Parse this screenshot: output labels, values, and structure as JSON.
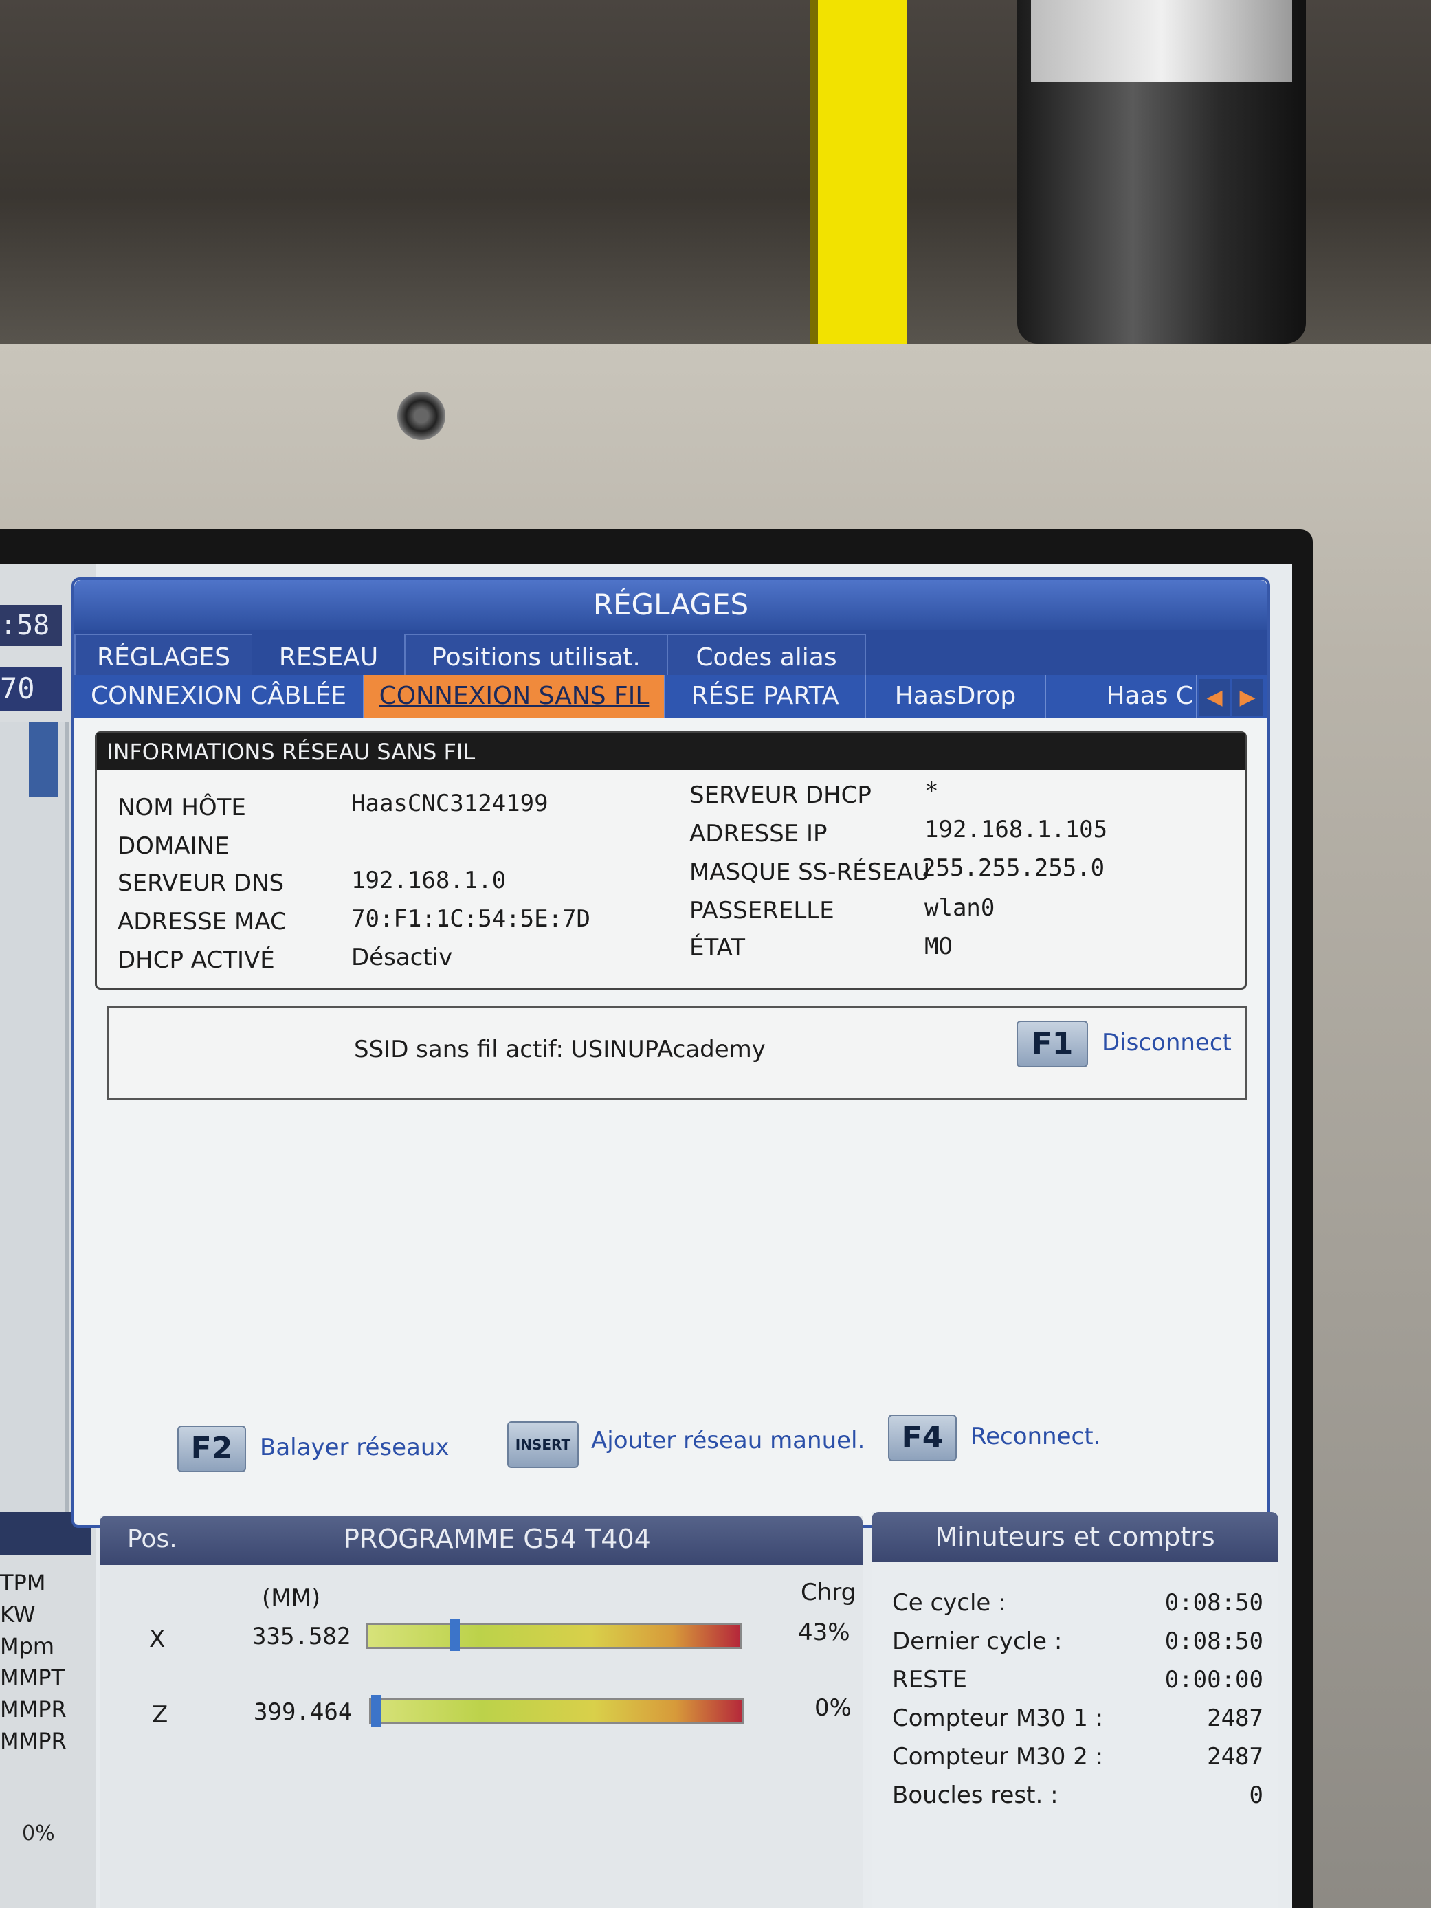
{
  "window": {
    "title": "RÉGLAGES"
  },
  "left_strip": {
    "time_fragment": ":58",
    "number_fragment": "70",
    "labels": [
      "TPM",
      "KW",
      "Mpm",
      "MMPT",
      "MMPR",
      "MMPR"
    ],
    "percent": "0%"
  },
  "tabs_primary": [
    {
      "label": "RÉGLAGES",
      "active": false
    },
    {
      "label": "RESEAU",
      "active": true
    },
    {
      "label": "Positions utilisat.",
      "active": false
    },
    {
      "label": "Codes alias",
      "active": false
    }
  ],
  "tabs_secondary": [
    {
      "label": "CONNEXION CÂBLÉE",
      "active": false
    },
    {
      "label": "CONNEXION SANS FIL",
      "active": true
    },
    {
      "label": "RÉSE PARTA",
      "active": false
    },
    {
      "label": "HaasDrop",
      "active": false
    },
    {
      "label": "Haas C",
      "active": false
    }
  ],
  "wireless_info": {
    "heading": "INFORMATIONS RÉSEAU SANS FIL",
    "left": [
      {
        "label": "NOM HÔTE",
        "value": "HaasCNC3124199"
      },
      {
        "label": "DOMAINE",
        "value": ""
      },
      {
        "label": "SERVEUR DNS",
        "value": "192.168.1.0"
      },
      {
        "label": "ADRESSE MAC",
        "value": "70:F1:1C:54:5E:7D"
      },
      {
        "label": "DHCP ACTIVÉ",
        "value": "Désactiv"
      }
    ],
    "right": [
      {
        "label": "SERVEUR DHCP",
        "value": "*"
      },
      {
        "label": "ADRESSE IP",
        "value": "192.168.1.105"
      },
      {
        "label": "MASQUE SS-RÉSEAU",
        "value": "255.255.255.0"
      },
      {
        "label": "PASSERELLE",
        "value": "wlan0"
      },
      {
        "label": "ÉTAT",
        "value": "MO"
      }
    ]
  },
  "ssid": {
    "text": "SSID sans fil actif: USINUPAcademy",
    "key": "F1",
    "action": "Disconnect"
  },
  "actions": [
    {
      "key": "F2",
      "label": "Balayer réseaux"
    },
    {
      "key": "INSERT",
      "label": "Ajouter réseau manuel."
    },
    {
      "key": "F4",
      "label": "Reconnect."
    }
  ],
  "position": {
    "title": "Pos.",
    "program": "PROGRAMME G54 T404",
    "unit": "(MM)",
    "load_header": "Chrg",
    "axes": [
      {
        "axis": "X",
        "value": "335.582",
        "load": "43%",
        "load_fraction": 0.43,
        "marker_fraction": 0.22
      },
      {
        "axis": "Z",
        "value": "399.464",
        "load": "0%",
        "load_fraction": 0.0,
        "marker_fraction": 0.0
      }
    ]
  },
  "timers": {
    "title": "Minuteurs et comptrs",
    "rows": [
      {
        "label": "Ce cycle :",
        "value": "0:08:50"
      },
      {
        "label": "Dernier cycle :",
        "value": "0:08:50"
      },
      {
        "label": "RESTE",
        "value": "0:00:00"
      },
      {
        "label": "Compteur M30 1 :",
        "value": "2487"
      },
      {
        "label": "Compteur M30 2 :",
        "value": "2487"
      },
      {
        "label": "Boucles rest. :",
        "value": "0"
      }
    ]
  },
  "colors": {
    "title_bar": "#2d4f9f",
    "active_tab": "#f08a3c",
    "action_text": "#2b4fa8",
    "panel_header": "#3b4770"
  }
}
